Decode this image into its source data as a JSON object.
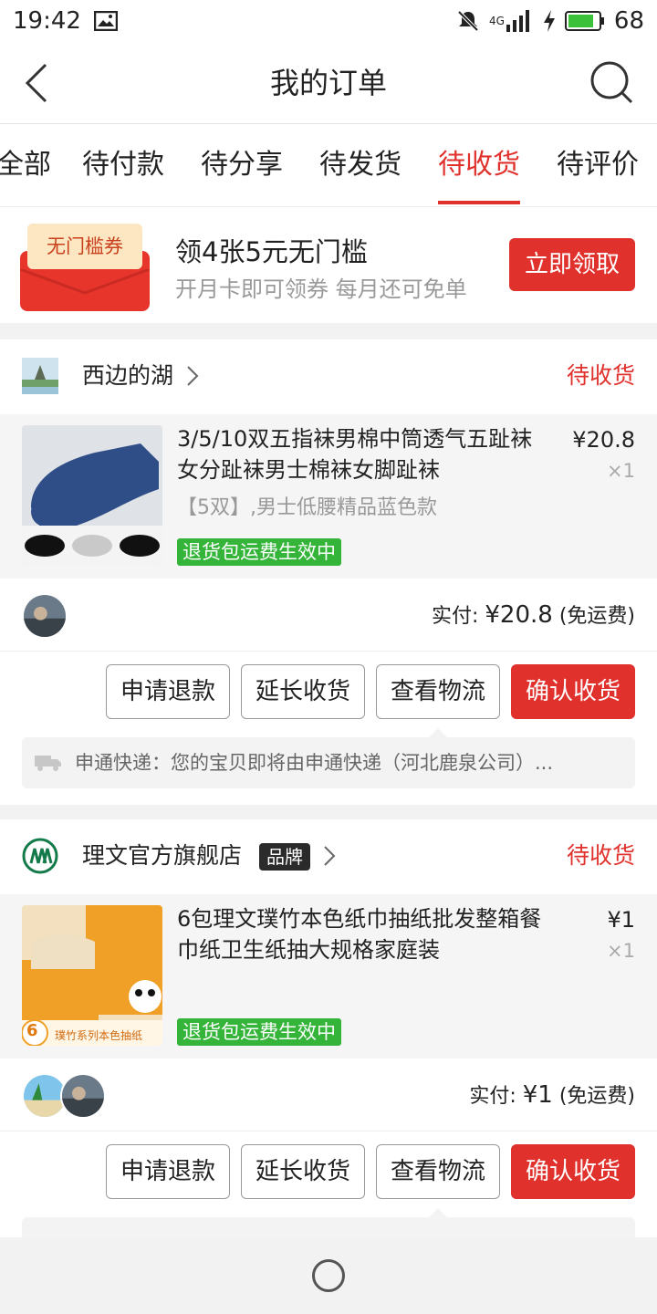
{
  "status": {
    "time": "19:42",
    "network": "4G",
    "battery": "68"
  },
  "nav": {
    "title": "我的订单"
  },
  "tabs": [
    "全部",
    "待付款",
    "待分享",
    "待发货",
    "待收货",
    "待评价"
  ],
  "active_tab": "待收货",
  "promo": {
    "tag": "无门槛券",
    "headline": "领4张5元无门槛",
    "sub": "开月卡即可领券 每月还可免单",
    "button": "立即领取"
  },
  "orders": [
    {
      "shop": "西边的湖",
      "state": "待收货",
      "title": "3/5/10双五指袜男棉中筒透气五趾袜女分趾袜男士棉袜女脚趾袜",
      "spec": "【5双】,男士低腰精品蓝色款",
      "price": "¥20.8",
      "qty": "×1",
      "badge": "退货包运费生效中",
      "pay_label": "实付: ",
      "pay_amount": "¥20.8",
      "pay_note": " (免运费)",
      "buttons": [
        "申请退款",
        "延长收货",
        "查看物流",
        "确认收货"
      ],
      "logistics": "申通快递：您的宝贝即将由申通快递（河北鹿泉公司）..."
    },
    {
      "shop": "理文官方旗舰店",
      "brand": "品牌",
      "state": "待收货",
      "title": "6包理文璞竹本色纸巾抽纸批发整箱餐巾纸卫生纸抽大规格家庭装",
      "price": "¥1",
      "qty": "×1",
      "badge": "退货包运费生效中",
      "thumb_text": "璞竹系列本色抽纸",
      "thumb_count": "6",
      "pay_label": "实付: ",
      "pay_amount": "¥1",
      "pay_note": " (免运费)",
      "buttons": [
        "申请退款",
        "延长收货",
        "查看物流",
        "确认收货"
      ]
    }
  ],
  "colors": {
    "accent": "#e0312c",
    "badge_green": "#34b53a"
  }
}
